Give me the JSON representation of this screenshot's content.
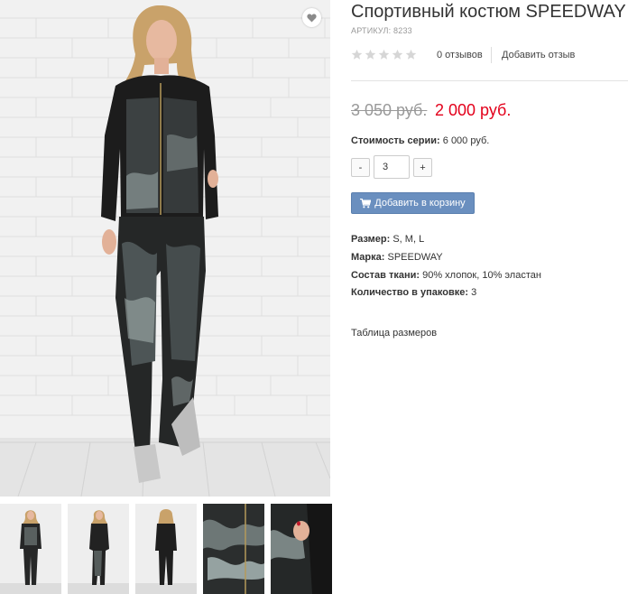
{
  "product": {
    "title": "Спортивный костюм SPEEDWAY",
    "sku": "АРТИКУЛ: 8233",
    "rating": 0,
    "rating_max": 5,
    "reviews_count": "0 отзывов",
    "add_review": "Добавить отзыв",
    "old_price": "3 050 руб.",
    "new_price": "2 000 руб.",
    "series_label": "Стоимость серии:",
    "series_value": "6 000 руб."
  },
  "quantity": {
    "minus_label": "-",
    "value": "3",
    "plus_label": "+"
  },
  "cart": {
    "button_label": "Добавить в корзину",
    "icon": "cart-icon"
  },
  "specs": [
    {
      "label": "Размер:",
      "value": "S, M, L"
    },
    {
      "label": "Марка:",
      "value": "SPEEDWAY"
    },
    {
      "label": "Состав ткани:",
      "value": "90% хлопок, 10% эластан"
    },
    {
      "label": "Количество в упаковке:",
      "value": "3"
    }
  ],
  "size_table_link": "Таблица размеров",
  "icons": {
    "favorite": "heart-icon",
    "star": "star-icon"
  },
  "colors": {
    "new_price": "#e3001b",
    "old_price": "#999999",
    "cart_button": "#6a8fbf",
    "star_empty": "#d6d6d6"
  }
}
